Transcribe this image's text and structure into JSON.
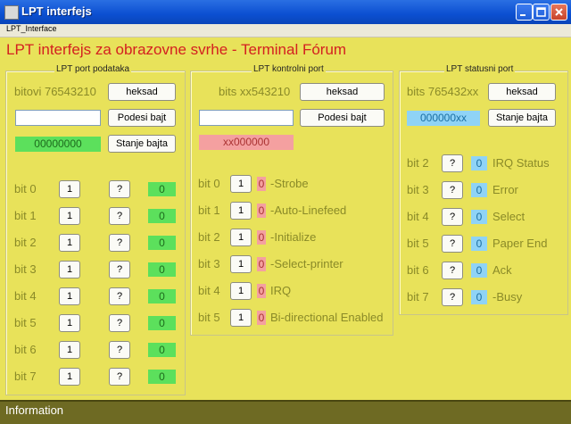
{
  "window": {
    "title": "LPT interfejs",
    "menu": "LPT_Interface"
  },
  "heading": "LPT interfejs za obrazovne svrhe - Terminal Fórum",
  "data_port": {
    "title": "LPT port podataka",
    "bits_label": "bitovi 76543210",
    "hex_button": "heksad",
    "set_button": "Podesi bajt",
    "state_button": "Stanje bajta",
    "input_value": "",
    "display": "00000000",
    "rows": [
      {
        "bit": "bit 0",
        "toggle": "1",
        "query": "?",
        "value": "0"
      },
      {
        "bit": "bit 1",
        "toggle": "1",
        "query": "?",
        "value": "0"
      },
      {
        "bit": "bit 2",
        "toggle": "1",
        "query": "?",
        "value": "0"
      },
      {
        "bit": "bit 3",
        "toggle": "1",
        "query": "?",
        "value": "0"
      },
      {
        "bit": "bit 4",
        "toggle": "1",
        "query": "?",
        "value": "0"
      },
      {
        "bit": "bit 5",
        "toggle": "1",
        "query": "?",
        "value": "0"
      },
      {
        "bit": "bit 6",
        "toggle": "1",
        "query": "?",
        "value": "0"
      },
      {
        "bit": "bit 7",
        "toggle": "1",
        "query": "?",
        "value": "0"
      }
    ]
  },
  "control_port": {
    "title": "LPT kontrolni port",
    "bits_label": "bits xx543210",
    "hex_button": "heksad",
    "set_button": "Podesi bajt",
    "input_value": "",
    "display": "xx000000",
    "rows": [
      {
        "bit": "bit 0",
        "toggle": "1",
        "value": "0",
        "desc": "-Strobe"
      },
      {
        "bit": "bit 1",
        "toggle": "1",
        "value": "0",
        "desc": "-Auto-Linefeed"
      },
      {
        "bit": "bit 2",
        "toggle": "1",
        "value": "0",
        "desc": "-Initialize"
      },
      {
        "bit": "bit 3",
        "toggle": "1",
        "value": "0",
        "desc": "-Select-printer"
      },
      {
        "bit": "bit 4",
        "toggle": "1",
        "value": "0",
        "desc": "IRQ"
      },
      {
        "bit": "bit 5",
        "toggle": "1",
        "value": "0",
        "desc": "Bi-directional Enabled"
      }
    ]
  },
  "status_port": {
    "title": "LPT statusni port",
    "bits_label": "bits 765432xx",
    "hex_button": "heksad",
    "state_button": "Stanje bajta",
    "display": "000000xx",
    "rows": [
      {
        "bit": "bit 2",
        "query": "?",
        "value": "0",
        "desc": "IRQ Status"
      },
      {
        "bit": "bit 3",
        "query": "?",
        "value": "0",
        "desc": "Error"
      },
      {
        "bit": "bit 4",
        "query": "?",
        "value": "0",
        "desc": "Select"
      },
      {
        "bit": "bit 5",
        "query": "?",
        "value": "0",
        "desc": "Paper End"
      },
      {
        "bit": "bit 6",
        "query": "?",
        "value": "0",
        "desc": "Ack"
      },
      {
        "bit": "bit 7",
        "query": "?",
        "value": "0",
        "desc": "-Busy"
      }
    ]
  },
  "statusbar": "Information",
  "icons": {
    "app": "app-icon",
    "minimize": "minimize-icon",
    "maximize": "maximize-icon",
    "close": "close-icon"
  },
  "colors": {
    "background": "#e8e25a",
    "heading": "#d42020",
    "green_display": "#5ce05c",
    "pink_display": "#f4a0a0",
    "blue_display": "#8fd3f6",
    "titlebar": "#0b4fd1"
  }
}
